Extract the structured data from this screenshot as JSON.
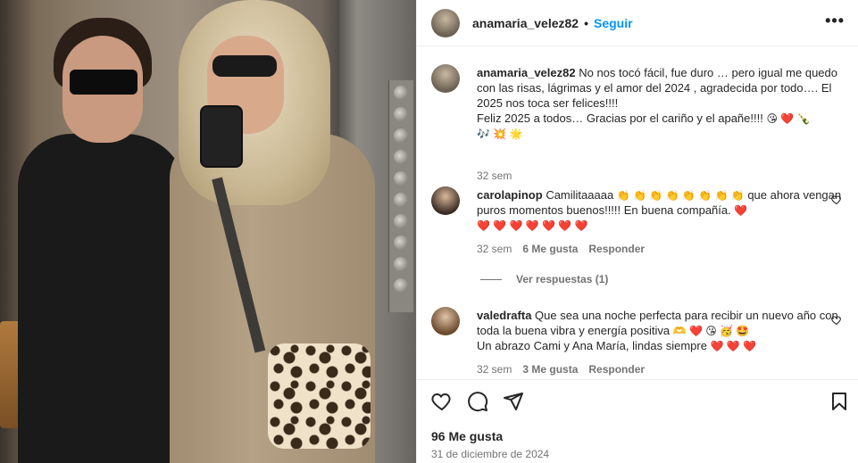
{
  "header": {
    "username": "anamaria_velez82",
    "separator": "•",
    "follow_label": "Seguir",
    "more_icon": "more-options-icon"
  },
  "caption": {
    "username": "anamaria_velez82",
    "text": "No nos tocó fácil, fue duro … pero igual me quedo con las risas, lágrimas y el amor del 2024 , agradecida por todo…. El 2025 nos toca ser felices!!!!",
    "text2": "Feliz 2025 a todos… Gracias por el cariño y el apañe!!!!",
    "emojis_line1": "😘 ❤️ 🍾",
    "emojis_line2": "🎶 💥 🌟",
    "time": "32 sem"
  },
  "comments": [
    {
      "username": "carolapinop",
      "text_a": "Camilitaaaaa",
      "emojis_a": "👏 👏 👏 👏 👏 👏 👏 👏",
      "text_b": "que ahora vengan puros momentos buenos!!!!! En buena compañía.",
      "emojis_b": "❤️",
      "emojis_c": "❤️ ❤️ ❤️ ❤️ ❤️ ❤️ ❤️",
      "time": "32 sem",
      "likes": "6 Me gusta",
      "reply": "Responder",
      "view_replies": "Ver respuestas (1)"
    },
    {
      "username": "valedrafta",
      "text_a": "Que sea una noche perfecta para recibir un nuevo año con toda la buena vibra y energía positiva",
      "emojis_a": "🫶 ❤️ 😘 🥳 🤩",
      "text_b": "Un abrazo Cami y Ana María, lindas siempre",
      "emojis_b": "❤️ ❤️ ❤️",
      "time": "32 sem",
      "likes": "3 Me gusta",
      "reply": "Responder"
    }
  ],
  "actions": {
    "likes": "96 Me gusta",
    "date": "31 de diciembre de 2024"
  }
}
